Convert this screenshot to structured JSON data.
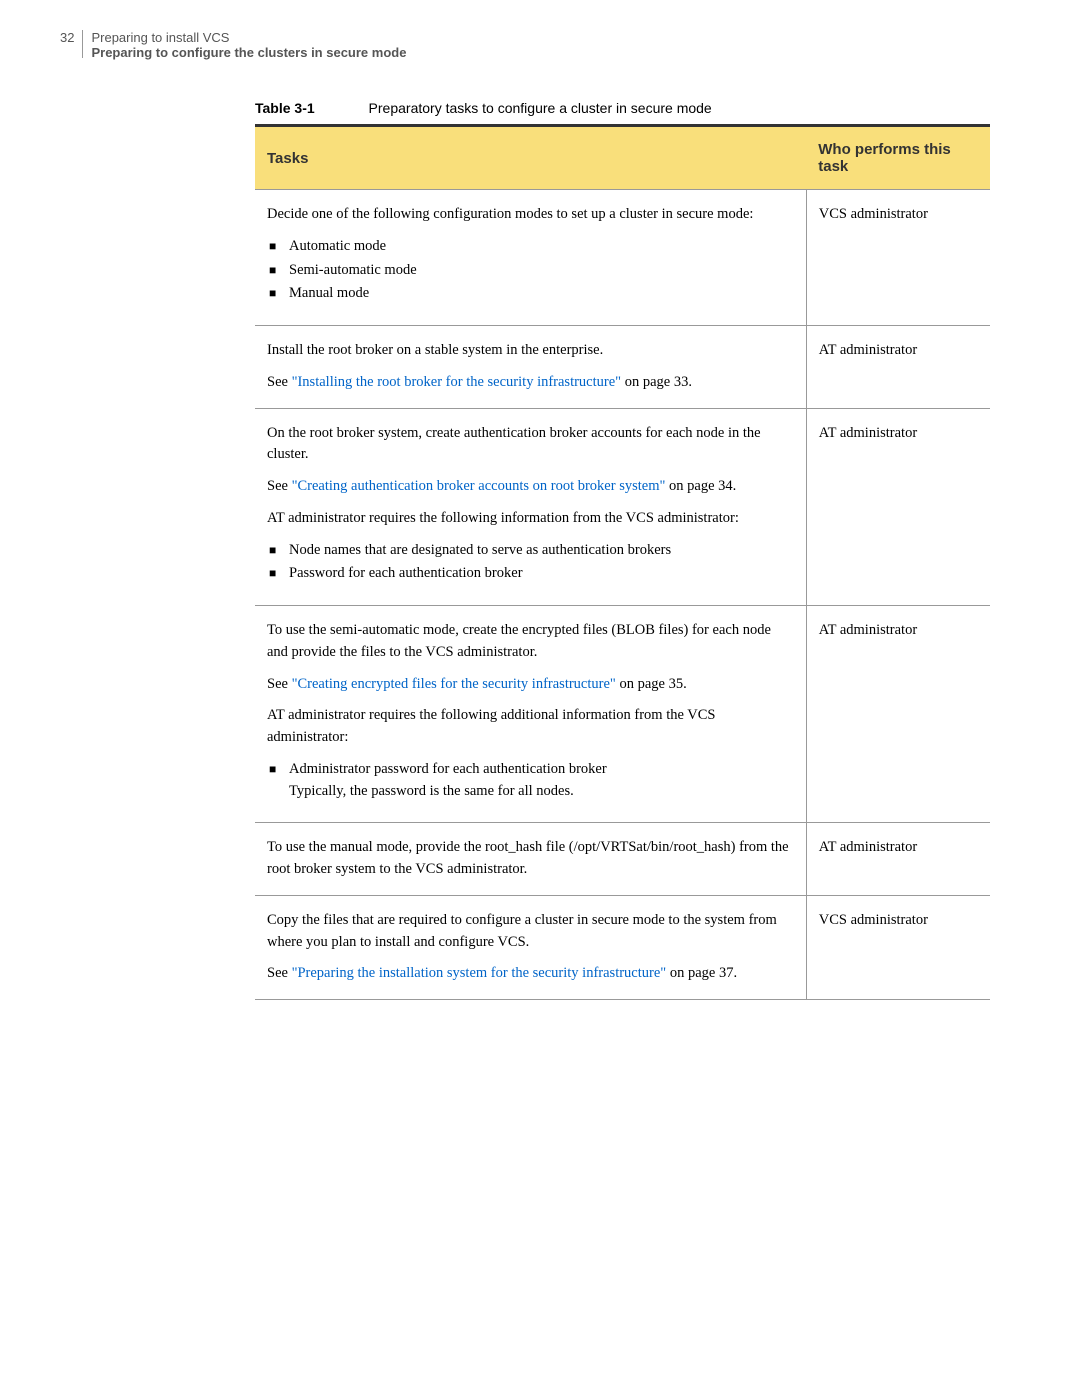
{
  "header": {
    "page_number": "32",
    "line1": "Preparing to install VCS",
    "line2": "Preparing to configure the clusters in secure mode"
  },
  "table": {
    "caption_label": "Table 3-1",
    "caption_text": "Preparatory tasks to configure a cluster in secure mode",
    "headers": {
      "col1": "Tasks",
      "col2": "Who performs this task"
    },
    "rows": [
      {
        "col2": "VCS administrator",
        "intro": "Decide one of the following configuration modes to set up a cluster in secure mode:",
        "bullets": [
          "Automatic mode",
          "Semi-automatic mode",
          "Manual mode"
        ]
      },
      {
        "col2": "AT administrator",
        "p1": "Install the root broker on a stable system in the enterprise.",
        "link_pre": "See ",
        "link_text": "\"Installing the root broker for the security infrastructure\"",
        "link_post": " on page 33."
      },
      {
        "col2": "AT administrator",
        "p1": "On the root broker system, create authentication broker accounts for each node in the cluster.",
        "link_pre": "See ",
        "link_text": "\"Creating authentication broker accounts on root broker system\"",
        "link_post": " on page 34.",
        "p2": "AT administrator requires the following information from the VCS administrator:",
        "bullets": [
          "Node names that are designated to serve as authentication brokers",
          "Password for each authentication broker"
        ]
      },
      {
        "col2": "AT administrator",
        "p1": "To use the semi-automatic mode, create the encrypted files (BLOB files) for each node and provide the files to the VCS administrator.",
        "link_pre": "See ",
        "link_text": "\"Creating encrypted files for the security infrastructure\"",
        "link_post": " on page 35.",
        "p2": "AT administrator requires the following additional information from the VCS administrator:",
        "bullets_multi": [
          {
            "l1": "Administrator password for each authentication broker",
            "l2": "Typically, the password is the same for all nodes."
          }
        ]
      },
      {
        "col2": "AT administrator",
        "p1": "To use the manual mode, provide the root_hash file (/opt/VRTSat/bin/root_hash) from the root broker system to the VCS administrator."
      },
      {
        "col2": "VCS administrator",
        "p1": "Copy the files that are required to configure a cluster in secure mode to the system from where you plan to install and configure VCS.",
        "link_pre": "See ",
        "link_text": "\"Preparing the installation system for the security infrastructure\"",
        "link_post": " on page 37."
      }
    ]
  }
}
